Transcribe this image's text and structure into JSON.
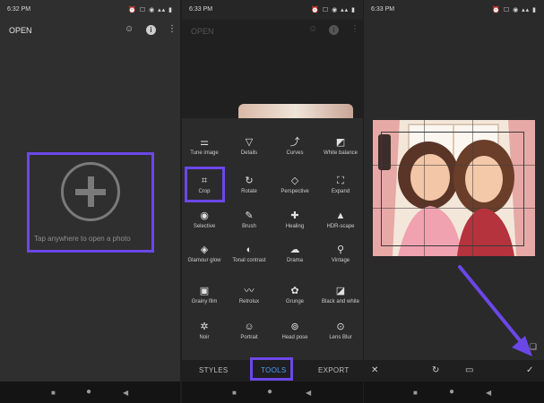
{
  "status_bars": [
    {
      "time": "6:32 PM",
      "icons": "⏰ ☐ ◉  ▴▴ ▮"
    },
    {
      "time": "6:33 PM",
      "icons": "⏰ ☐ ◉  ▴▴ ▮"
    },
    {
      "time": "6:33 PM",
      "icons": "⏰ ☐ ◉  ▴▴ ▮"
    }
  ],
  "screen1": {
    "open_label": "OPEN",
    "tap_text": "Tap anywhere to open a photo",
    "icons": {
      "lookup": "lookup-icon",
      "info": "info-icon",
      "menu": "more-vert-icon"
    }
  },
  "screen2": {
    "open_label": "OPEN",
    "tools": [
      {
        "label": "Tune image",
        "icon": "⚌"
      },
      {
        "label": "Details",
        "icon": "▽"
      },
      {
        "label": "Curves",
        "icon": "⤴"
      },
      {
        "label": "White balance",
        "icon": "◩"
      },
      {
        "label": "Crop",
        "icon": "⌗"
      },
      {
        "label": "Rotate",
        "icon": "↻"
      },
      {
        "label": "Perspective",
        "icon": "◇"
      },
      {
        "label": "Expand",
        "icon": "⛶"
      },
      {
        "label": "Selective",
        "icon": "◉"
      },
      {
        "label": "Brush",
        "icon": "✎"
      },
      {
        "label": "Healing",
        "icon": "✚"
      },
      {
        "label": "HDR-scape",
        "icon": "▲"
      },
      {
        "label": "Glamour glow",
        "icon": "◈"
      },
      {
        "label": "Tonal contrast",
        "icon": "◐"
      },
      {
        "label": "Drama",
        "icon": "☁"
      },
      {
        "label": "Vintage",
        "icon": "⚲"
      },
      {
        "label": "Grainy film",
        "icon": "▣"
      },
      {
        "label": "Retrolux",
        "icon": "〰"
      },
      {
        "label": "Grunge",
        "icon": "✿"
      },
      {
        "label": "Black and white",
        "icon": "◪"
      },
      {
        "label": "Noir",
        "icon": "✲"
      },
      {
        "label": "Portrait",
        "icon": "☺"
      },
      {
        "label": "Head pose",
        "icon": "⊚"
      },
      {
        "label": "Lens Blur",
        "icon": "⊙"
      }
    ],
    "tabs": {
      "styles": "STYLES",
      "tools": "TOOLS",
      "export": "EXPORT"
    }
  },
  "screen3": {
    "bottom_icons": {
      "cancel": "✕",
      "rotate": "↻",
      "aspect": "▭",
      "confirm": "✓"
    }
  },
  "nav_icons": {
    "home": "●",
    "back": "◀",
    "recents": "■"
  },
  "colors": {
    "highlight": "#6b47e8",
    "active_tab": "#4e9dff"
  }
}
